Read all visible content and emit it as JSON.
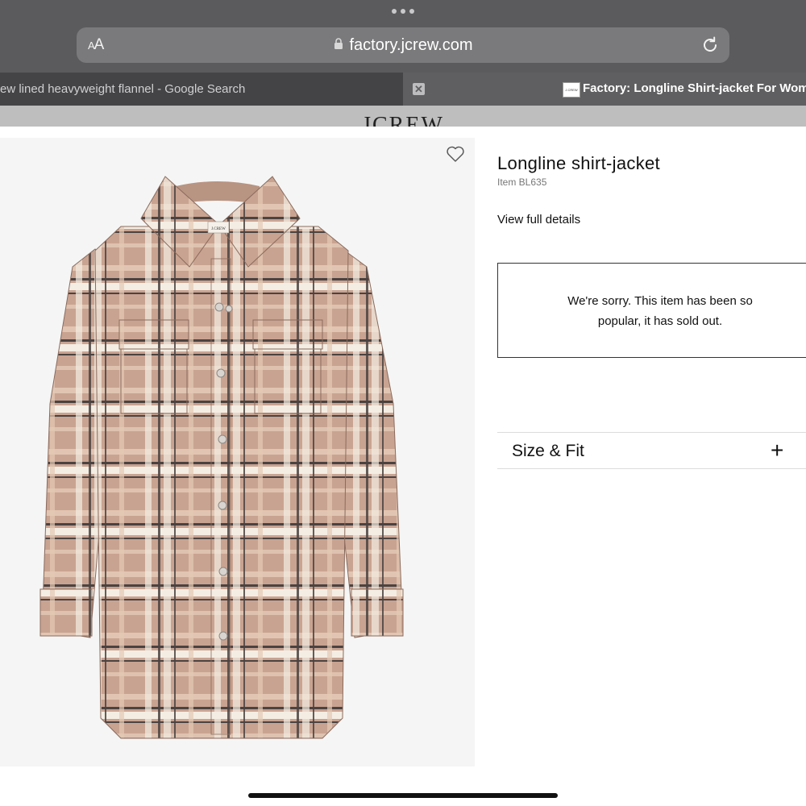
{
  "browser": {
    "url": "factory.jcrew.com",
    "text_size_button": {
      "small": "A",
      "large": "A"
    },
    "tabs": [
      {
        "label": "ew lined heavyweight flannel - Google Search",
        "active": false
      },
      {
        "label": "Factory: Longline Shirt-jacket For Wom",
        "active": true
      }
    ],
    "close_glyph": "✕",
    "favicon_text": "J.CREW"
  },
  "site": {
    "logo": "JCREW"
  },
  "product": {
    "title": "Longline shirt-jacket",
    "item_number": "Item BL635",
    "view_details": "View full details",
    "sold_out_message": "We're sorry. This item has been so popular, it has sold out.",
    "image_label": "J.CREW",
    "favorited": false
  },
  "accordion": {
    "size_fit": {
      "label": "Size & Fit",
      "toggle": "+"
    }
  },
  "icons": {
    "lock": "lock-icon",
    "reload": "reload-icon",
    "heart": "heart-icon",
    "plus": "plus-icon",
    "close": "close-icon",
    "more": "more-dots-icon"
  },
  "colors": {
    "chrome": "#5b5b5d",
    "url_bar": "#7a7a7c",
    "inactive_tab": "#444446",
    "active_tab": "#5f5f61",
    "flannel_base": "#c8a290",
    "flannel_dark_stripe": "#4a4341",
    "flannel_light_stripe": "#f3ece2"
  }
}
